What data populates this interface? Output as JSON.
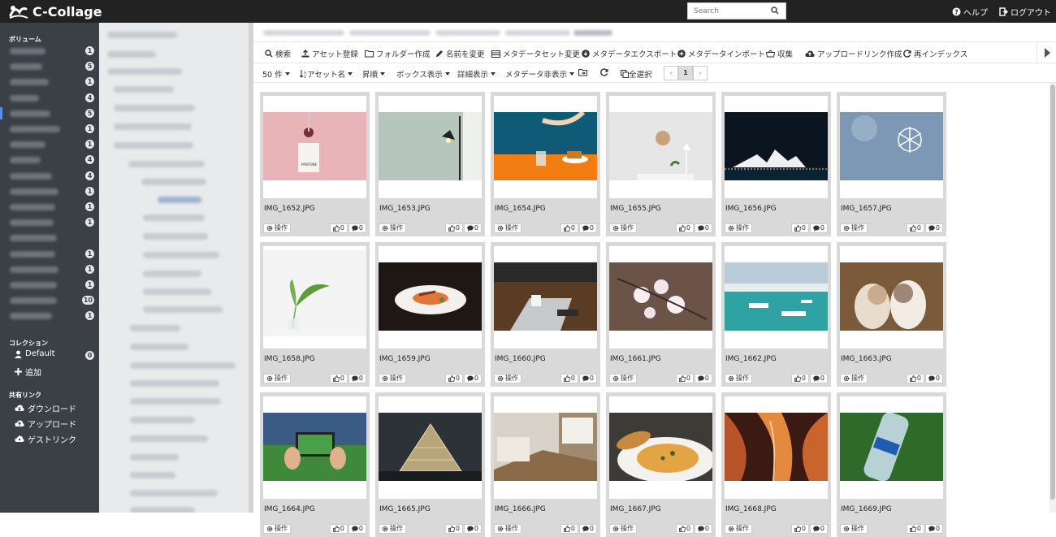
{
  "app": {
    "title": "C-Collage",
    "search_placeholder": "Search",
    "help": "ヘルプ",
    "logout": "ログアウト"
  },
  "sidebar": {
    "volume_title": "ボリューム",
    "volumes": [
      {
        "count": "1"
      },
      {
        "count": "5"
      },
      {
        "count": "1"
      },
      {
        "count": "4"
      },
      {
        "count": "5",
        "active": true
      },
      {
        "count": "1"
      },
      {
        "count": "1"
      },
      {
        "count": "4"
      },
      {
        "count": "4"
      },
      {
        "count": "1"
      },
      {
        "count": "1"
      },
      {
        "count": "1"
      },
      {
        "count": ""
      },
      {
        "count": "1"
      },
      {
        "count": "1"
      },
      {
        "count": "1"
      },
      {
        "count": "10"
      },
      {
        "count": "1"
      }
    ],
    "collection_title": "コレクション",
    "collection_default": "Default",
    "collection_default_count": "0",
    "collection_add": "追加",
    "share_title": "共有リンク",
    "share_download": "ダウンロード",
    "share_upload": "アップロード",
    "share_guest": "ゲストリンク"
  },
  "toolbar": {
    "search": "検索",
    "asset_register": "アセット登録",
    "folder_create": "フォルダー作成",
    "rename": "名前を変更",
    "metadata_set": "メタデータセット変更",
    "metadata_export": "メタデータエクスポート",
    "metadata_import": "メタデータインポート",
    "collect": "収集",
    "upload_link": "アップロードリンク作成",
    "reindex": "再インデックス"
  },
  "toolbar2": {
    "per_page": "50 件",
    "sort_by": "アセット名",
    "order": "昇順",
    "box_view": "ボックス表示",
    "detail_view": "詳細表示",
    "metadata_hide": "メタデータ非表示",
    "select_all": "全選択",
    "page": "1"
  },
  "card_labels": {
    "operation": "操作"
  },
  "assets": [
    {
      "name": "IMG_1652.JPG",
      "likes": "0",
      "comments": "0"
    },
    {
      "name": "IMG_1653.JPG",
      "likes": "0",
      "comments": "0"
    },
    {
      "name": "IMG_1654.JPG",
      "likes": "0",
      "comments": "0"
    },
    {
      "name": "IMG_1655.JPG",
      "likes": "0",
      "comments": "0"
    },
    {
      "name": "IMG_1656.JPG",
      "likes": "0",
      "comments": "0"
    },
    {
      "name": "IMG_1657.JPG",
      "likes": "0",
      "comments": "0"
    },
    {
      "name": "IMG_1658.JPG",
      "likes": "0",
      "comments": "0"
    },
    {
      "name": "IMG_1659.JPG",
      "likes": "0",
      "comments": "0"
    },
    {
      "name": "IMG_1660.JPG",
      "likes": "0",
      "comments": "0"
    },
    {
      "name": "IMG_1661.JPG",
      "likes": "0",
      "comments": "0"
    },
    {
      "name": "IMG_1662.JPG",
      "likes": "0",
      "comments": "0"
    },
    {
      "name": "IMG_1663.JPG",
      "likes": "0",
      "comments": "0"
    },
    {
      "name": "IMG_1664.JPG",
      "likes": "0",
      "comments": "0"
    },
    {
      "name": "IMG_1665.JPG",
      "likes": "0",
      "comments": "0"
    },
    {
      "name": "IMG_1666.JPG",
      "likes": "0",
      "comments": "0"
    },
    {
      "name": "IMG_1667.JPG",
      "likes": "0",
      "comments": "0"
    },
    {
      "name": "IMG_1668.JPG",
      "likes": "0",
      "comments": "0"
    },
    {
      "name": "IMG_1669.JPG",
      "likes": "0",
      "comments": "0"
    }
  ],
  "colors": {
    "topbar": "#222222",
    "sidebar": "#3b4046",
    "tree": "#e9eaeb",
    "card": "#d9d9d9"
  }
}
